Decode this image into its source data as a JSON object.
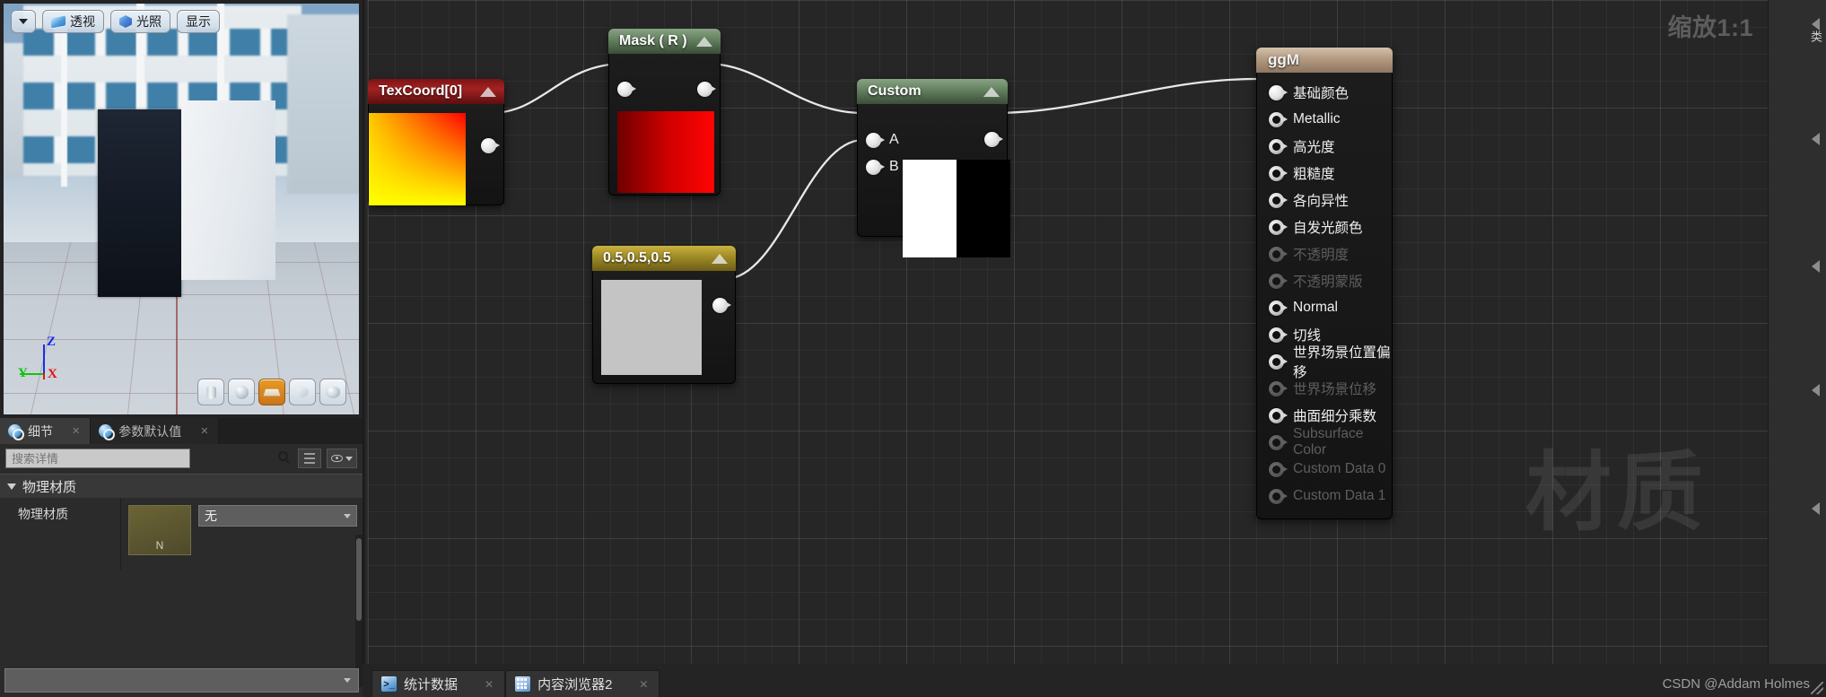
{
  "viewport": {
    "toolbar": [
      {
        "name": "viewport-options-button",
        "label": "",
        "icon": "chevron-down-icon"
      },
      {
        "name": "view-mode-perspective-button",
        "label": "透视",
        "icon": "perspective-icon"
      },
      {
        "name": "view-mode-lit-button",
        "label": "光照",
        "icon": "cube-icon"
      },
      {
        "name": "show-flags-button",
        "label": "显示",
        "icon": ""
      }
    ],
    "axis": {
      "x": "X",
      "y": "Y",
      "z": "Z"
    },
    "shape_buttons": [
      {
        "name": "preview-shape-cylinder",
        "icon": "cylinder-icon"
      },
      {
        "name": "preview-shape-sphere",
        "icon": "sphere-icon"
      },
      {
        "name": "preview-shape-plane",
        "icon": "plane-icon"
      },
      {
        "name": "preview-shape-cube",
        "icon": "cube-icon"
      },
      {
        "name": "preview-shape-teapot",
        "icon": "teapot-icon"
      }
    ]
  },
  "details": {
    "tabs": [
      {
        "label": "细节",
        "active": true
      },
      {
        "label": "参数默认值",
        "active": false
      }
    ],
    "search_placeholder": "搜索详情",
    "close_glyph": "✕",
    "section_title": "物理材质",
    "property_label": "物理材质",
    "thumbnail_label": "N",
    "combo_value": "无"
  },
  "graph": {
    "zoom_label": "缩放1:1",
    "watermark": "材质",
    "credit": "CSDN @Addam Holmes",
    "nodes": [
      {
        "name": "texcoord-node",
        "title": "TexCoord[0]",
        "header_color": "#a32222",
        "preview": "uv-gradient"
      },
      {
        "name": "mask-node",
        "title": "Mask ( R )",
        "header_color": "#627f5e",
        "preview": "red-gradient"
      },
      {
        "name": "constant-node",
        "title": "0.5,0.5,0.5",
        "header_color": "#9e8a26",
        "preview": "gray"
      },
      {
        "name": "custom-node",
        "title": "Custom",
        "header_color": "#627f5e",
        "inputs": [
          "A",
          "B"
        ],
        "preview": "white-black-split"
      }
    ]
  },
  "material_node": {
    "title": "ggM",
    "pins": [
      {
        "label": "基础颜色",
        "connected": true,
        "disabled": false
      },
      {
        "label": "Metallic",
        "connected": false,
        "disabled": false
      },
      {
        "label": "高光度",
        "connected": false,
        "disabled": false
      },
      {
        "label": "粗糙度",
        "connected": false,
        "disabled": false
      },
      {
        "label": "各向异性",
        "connected": false,
        "disabled": false
      },
      {
        "label": "自发光颜色",
        "connected": false,
        "disabled": false
      },
      {
        "label": "不透明度",
        "connected": false,
        "disabled": true
      },
      {
        "label": "不透明蒙版",
        "connected": false,
        "disabled": true
      },
      {
        "label": "Normal",
        "connected": false,
        "disabled": false
      },
      {
        "label": "切线",
        "connected": false,
        "disabled": false
      },
      {
        "label": "世界场景位置偏移",
        "connected": false,
        "disabled": false
      },
      {
        "label": "世界场景位移",
        "connected": false,
        "disabled": true
      },
      {
        "label": "曲面细分乘数",
        "connected": false,
        "disabled": false
      },
      {
        "label": "Subsurface Color",
        "connected": false,
        "disabled": true
      },
      {
        "label": "Custom Data 0",
        "connected": false,
        "disabled": true
      },
      {
        "label": "Custom Data 1",
        "connected": false,
        "disabled": true
      }
    ]
  },
  "right_strip": {
    "tab_label": "类"
  },
  "bottom_bar": {
    "tabs": [
      {
        "label": "统计数据",
        "icon": "console-icon",
        "close": "✕"
      },
      {
        "label": "内容浏览器2",
        "icon": "content-browser-icon",
        "close": "✕"
      }
    ]
  }
}
